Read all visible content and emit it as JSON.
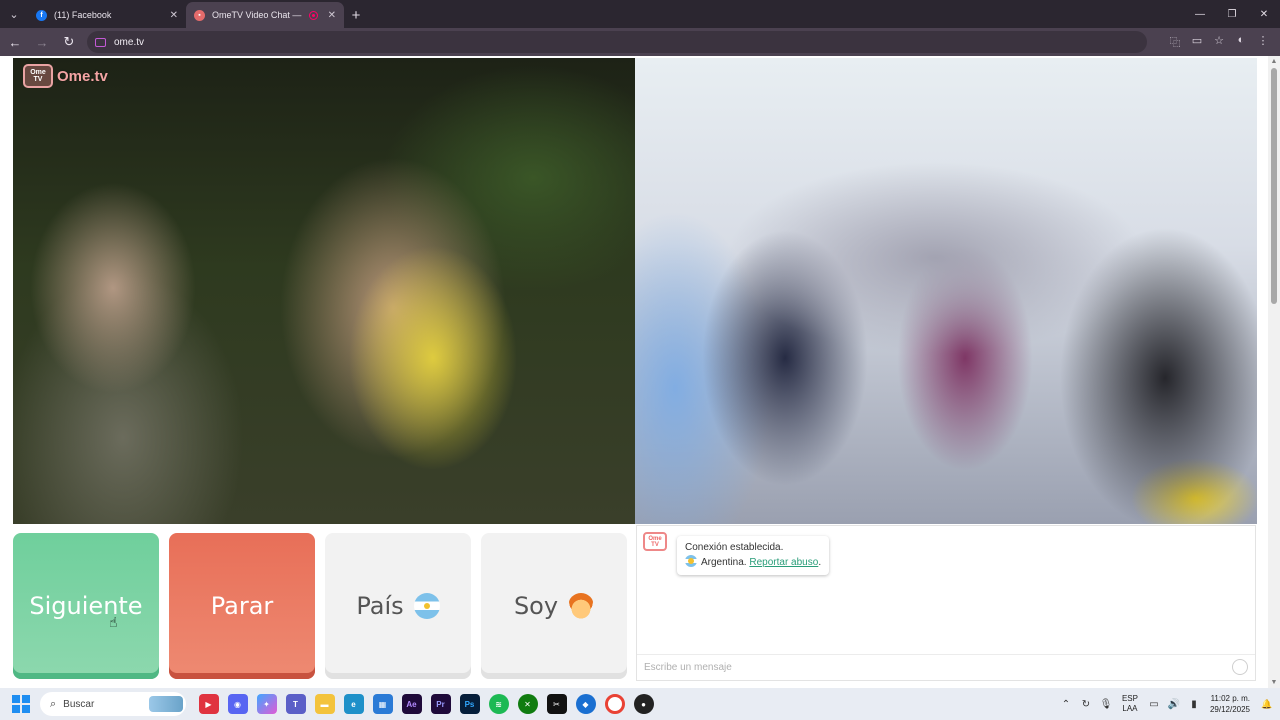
{
  "browser": {
    "tabs": [
      {
        "title": "(11) Facebook",
        "icon": "facebook-icon",
        "active": false
      },
      {
        "title": "OmeTV Video Chat — Ome",
        "icon": "ometv-icon",
        "active": true
      }
    ],
    "url": "ome.tv"
  },
  "page": {
    "logo_text": "Ome.tv",
    "logo_badge": "Ome TV",
    "buttons": {
      "next": "Siguiente",
      "stop": "Parar",
      "country": "País",
      "soy": "Soy"
    },
    "chat": {
      "connection": "Conexión establecida.",
      "country": "Argentina.",
      "report": "Reportar abuso",
      "report_suffix": ".",
      "placeholder": "Escribe un mensaje"
    }
  },
  "taskbar": {
    "search_placeholder": "Buscar",
    "lang_top": "ESP",
    "lang_bottom": "LAA",
    "time": "11:02 p. m.",
    "date": "29/12/2025"
  },
  "colors": {
    "next": "#6fcf9c",
    "stop": "#e86f58",
    "link": "#2a9d79"
  }
}
